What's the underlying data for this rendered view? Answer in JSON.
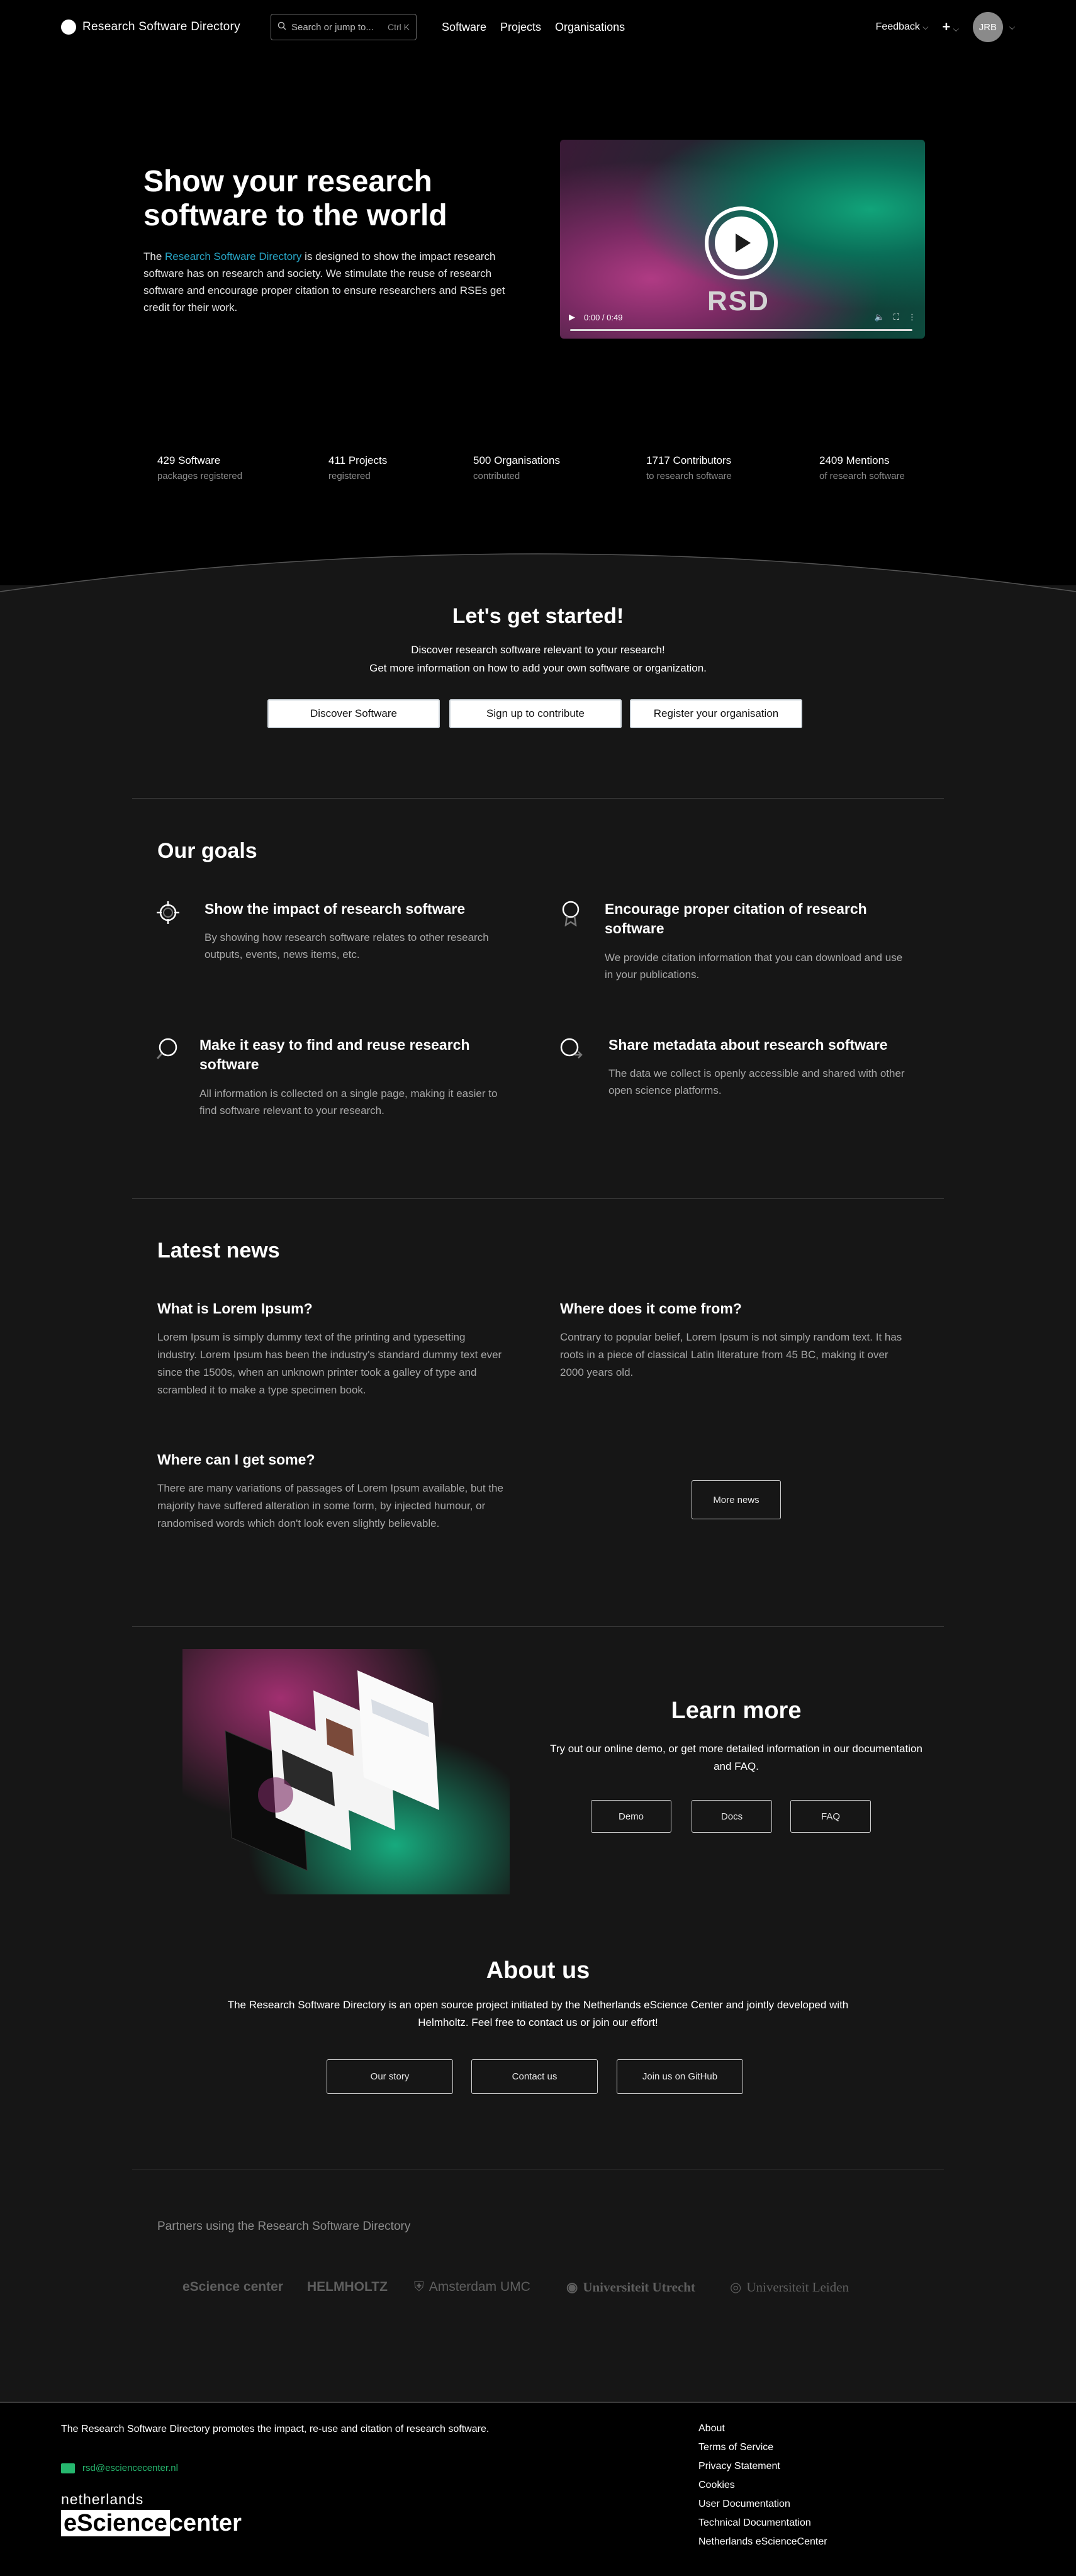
{
  "header": {
    "brand": "Research Software Directory",
    "search_placeholder": "Search or jump to...",
    "search_shortcut": "Ctrl K",
    "nav": [
      "Software",
      "Projects",
      "Organisations"
    ],
    "feedback": "Feedback",
    "add_label": "+",
    "avatar_initials": "JRB"
  },
  "hero": {
    "title": "Show your research software to the world",
    "text_prefix": "The ",
    "text_link": "Research Software Directory",
    "text_suffix": " is designed to show the impact research software has on research and society. We stimulate the reuse of research software and encourage proper citation to ensure researchers and RSEs get credit for their work.",
    "video": {
      "logo_text": "RSD",
      "time": "0:00 / 0:49"
    }
  },
  "stats": [
    {
      "value": "429 Software",
      "desc": "packages registered"
    },
    {
      "value": "411 Projects",
      "desc": "registered"
    },
    {
      "value": "500 Organisations",
      "desc": "contributed"
    },
    {
      "value": "1717 Contributors",
      "desc": "to research software"
    },
    {
      "value": "2409 Mentions",
      "desc": "of research software"
    }
  ],
  "get_started": {
    "title": "Let's get started!",
    "line1": "Discover research software relevant to your research!",
    "line2": "Get more information on how to add your own software or organization.",
    "buttons": [
      "Discover Software",
      "Sign up to contribute",
      "Register your organisation"
    ]
  },
  "goals": {
    "title": "Our goals",
    "items": [
      {
        "title": "Show the impact of research software",
        "text": "By showing how research software relates to other research outputs, events, news items, etc."
      },
      {
        "title": "Encourage proper citation of research software",
        "text": "We provide citation information that you can download and use in your publications."
      },
      {
        "title": "Make it easy to find and reuse research software",
        "text": "All information is collected on a single page, making it easier to find software relevant to your research."
      },
      {
        "title": "Share metadata about research software",
        "text": "The data we collect is openly accessible and shared with other open science platforms."
      }
    ]
  },
  "news": {
    "title": "Latest news",
    "items": [
      {
        "title": "What is Lorem Ipsum?",
        "text": "Lorem Ipsum is simply dummy text of the printing and typesetting industry. Lorem Ipsum has been the industry's standard dummy text ever since the 1500s, when an unknown printer took a galley of type and scrambled it to make a type specimen book."
      },
      {
        "title": "Where does it come from?",
        "text": "Contrary to popular belief, Lorem Ipsum is not simply random text. It has roots in a piece of classical Latin literature from 45 BC, making it over 2000 years old."
      },
      {
        "title": "Where can I get some?",
        "text": "There are many variations of passages of Lorem Ipsum available, but the majority have suffered alteration in some form, by injected humour, or randomised words which don't look even slightly believable."
      }
    ],
    "more_button": "More news"
  },
  "learn_more": {
    "title": "Learn more",
    "text": "Try out our online demo, or get more detailed information in our documentation and FAQ.",
    "buttons": [
      "Demo",
      "Docs",
      "FAQ"
    ]
  },
  "about": {
    "title": "About us",
    "text": "The Research Software Directory is an open source project initiated by the Netherlands eScience Center and jointly developed with Helmholtz. Feel free to contact us or join our effort!",
    "buttons": [
      "Our story",
      "Contact us",
      "Join us on GitHub"
    ]
  },
  "partners": {
    "title": "Partners using the Research Software Directory",
    "logos": [
      "eScience center",
      "HELMHOLTZ",
      "Amsterdam UMC",
      "Universiteit Utrecht",
      "Universiteit Leiden"
    ]
  },
  "footer": {
    "text": "The Research Software Directory promotes the impact, re-use and citation of research software.",
    "email": "rsd@esciencecenter.nl",
    "logo_line1": "netherlands",
    "logo_box": "eScience",
    "logo_tail": "center",
    "links": [
      "About",
      "Terms of Service",
      "Privacy Statement",
      "Cookies",
      "User Documentation",
      "Technical Documentation",
      "Netherlands eScienceCenter"
    ]
  },
  "colors": {
    "accent_link": "#27a4c4",
    "mail_green": "#26b76e",
    "section_bg": "#161616"
  }
}
